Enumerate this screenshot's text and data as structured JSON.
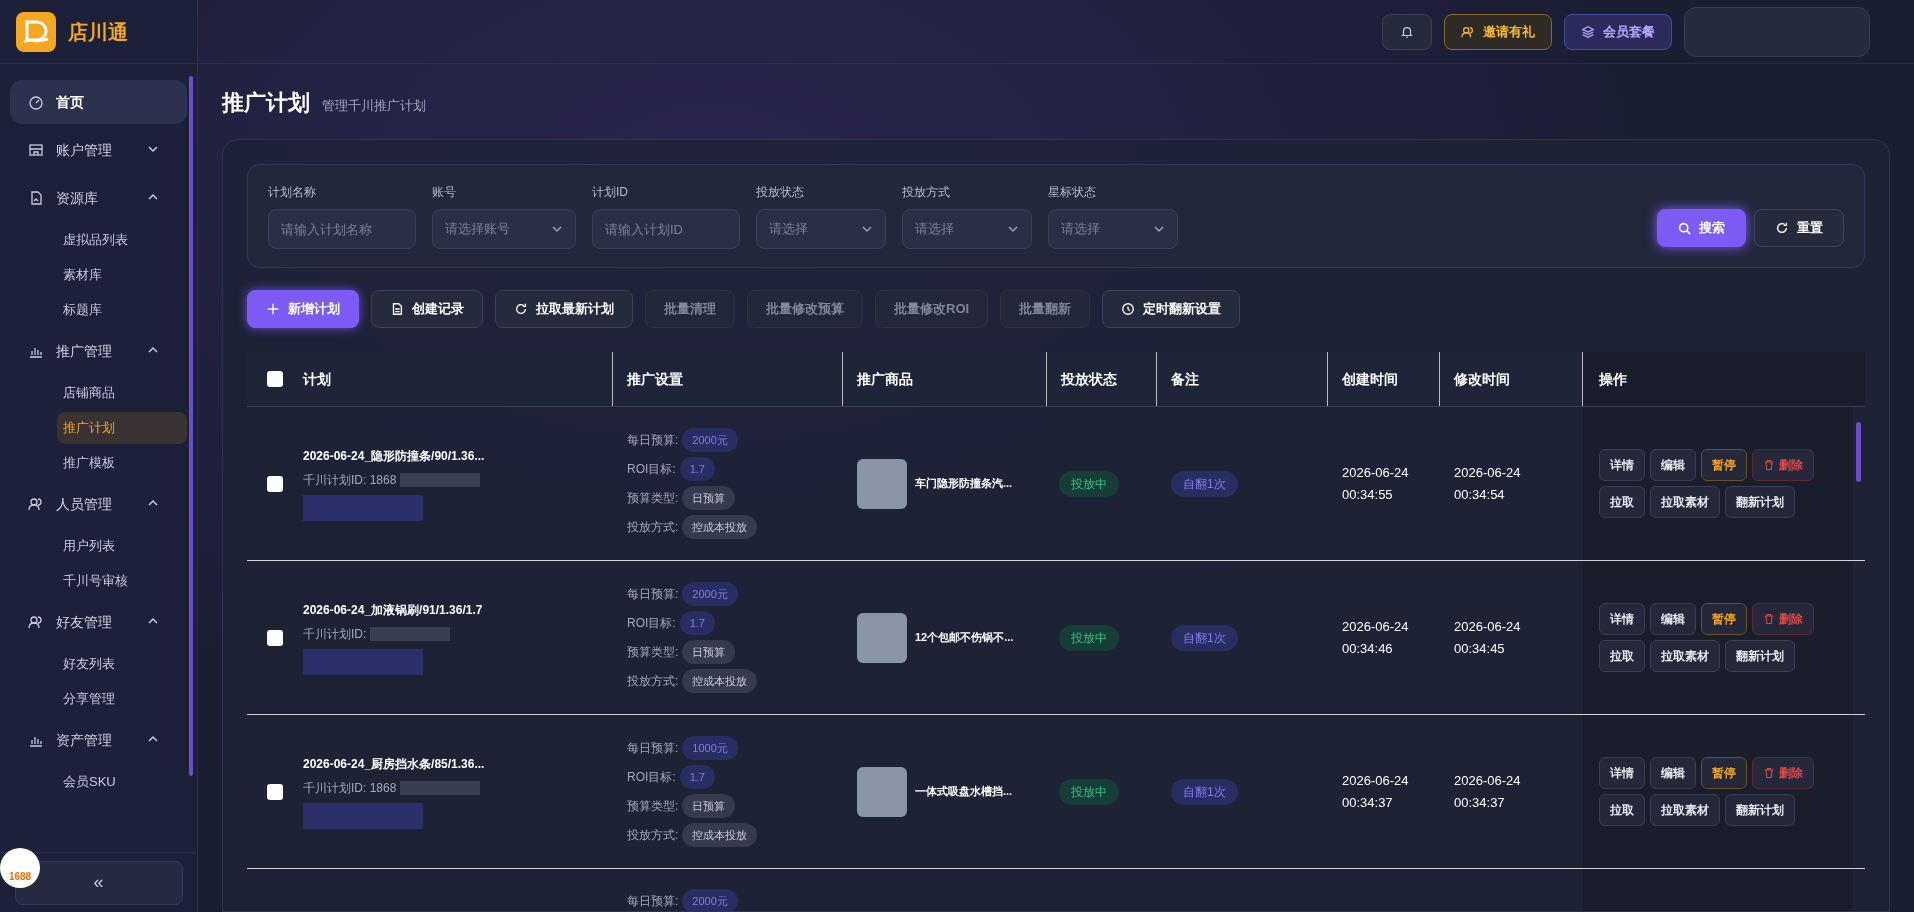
{
  "app": {
    "name": "店川通"
  },
  "sidebar": {
    "items": [
      {
        "label": "首页",
        "selected": true
      },
      {
        "label": "账户管理",
        "selected": false,
        "expanded": false
      },
      {
        "label": "资源库",
        "selected": false,
        "expanded": true,
        "children": [
          {
            "label": "虚拟品列表",
            "selected": false
          },
          {
            "label": "素材库",
            "selected": false
          },
          {
            "label": "标题库",
            "selected": false
          }
        ]
      },
      {
        "label": "推广管理",
        "selected": false,
        "expanded": true,
        "children": [
          {
            "label": "店铺商品",
            "selected": false
          },
          {
            "label": "推广计划",
            "selected": true
          },
          {
            "label": "推广模板",
            "selected": false
          }
        ]
      },
      {
        "label": "人员管理",
        "selected": false,
        "expanded": true,
        "children": [
          {
            "label": "用户列表",
            "selected": false
          },
          {
            "label": "千川号审核",
            "selected": false
          }
        ]
      },
      {
        "label": "好友管理",
        "selected": false,
        "expanded": true,
        "children": [
          {
            "label": "好友列表",
            "selected": false
          },
          {
            "label": "分享管理",
            "selected": false
          }
        ]
      },
      {
        "label": "资产管理",
        "selected": false,
        "expanded": true,
        "children": [
          {
            "label": "会员SKU",
            "selected": false
          }
        ]
      }
    ],
    "collapse_button": "«"
  },
  "corner_badge": "1688",
  "header": {
    "buttons": [
      {
        "kind": "icon"
      },
      {
        "kind": "gold",
        "label": "邀请有礼"
      },
      {
        "kind": "purple",
        "label": "会员套餐"
      }
    ]
  },
  "page": {
    "title": "推广计划",
    "subtitle": "管理千川推广计划"
  },
  "filters": [
    {
      "kind": "input",
      "label": "计划名称",
      "placeholder": "请输入计划名称"
    },
    {
      "kind": "select",
      "label": "账号",
      "placeholder": "请选择账号"
    },
    {
      "kind": "input",
      "label": "计划ID",
      "placeholder": "请输入计划ID"
    },
    {
      "kind": "select",
      "label": "投放状态",
      "placeholder": "请选择"
    },
    {
      "kind": "select",
      "label": "投放方式",
      "placeholder": "请选择"
    },
    {
      "kind": "select",
      "label": "星标状态",
      "placeholder": "请选择"
    }
  ],
  "filter_actions": [
    {
      "kind": "primary",
      "label": "搜索"
    },
    {
      "kind": "normal",
      "label": "重置"
    }
  ],
  "toolbar": [
    {
      "label": "新增计划",
      "kind": "primary",
      "disabled": false
    },
    {
      "label": "创建记录",
      "kind": "normal",
      "disabled": false
    },
    {
      "label": "拉取最新计划",
      "kind": "normal",
      "disabled": false
    },
    {
      "label": "批量清理",
      "kind": "normal",
      "disabled": true
    },
    {
      "label": "批量修改预算",
      "kind": "normal",
      "disabled": true
    },
    {
      "label": "批量修改ROI",
      "kind": "normal",
      "disabled": true
    },
    {
      "label": "批量翻新",
      "kind": "normal",
      "disabled": true
    },
    {
      "label": "定时翻新设置",
      "kind": "normal",
      "disabled": false
    }
  ],
  "table": {
    "select_all_checked": false,
    "columns": [
      "计划",
      "推广设置",
      "推广商品",
      "投放状态",
      "备注",
      "创建时间",
      "修改时间",
      "操作"
    ],
    "rows": [
      {
        "checked": false,
        "name": "2026-06-24_隐形防撞条/90/1.36...",
        "plan_id": "千川计划ID: 1868",
        "settings": [
          {
            "label": "每日预算:",
            "value": "2000元",
            "kind": "accent"
          },
          {
            "label": "ROI目标:",
            "value": "1.7",
            "kind": "accent"
          },
          {
            "label": "预算类型:",
            "value": "日预算",
            "kind": "plain"
          },
          {
            "label": "投放方式:",
            "value": "控成本投放",
            "kind": "plain"
          }
        ],
        "product": "车门隐形防撞条汽...",
        "status": "投放中",
        "note": "自翻1次",
        "created": "2026-06-24 00:34:55",
        "modified": "2026-06-24 00:34:54",
        "actions": [
          {
            "label": "详情",
            "kind": "normal"
          },
          {
            "label": "编辑",
            "kind": "normal"
          },
          {
            "label": "暂停",
            "kind": "warn"
          },
          {
            "label": "删除",
            "kind": "danger"
          },
          {
            "label": "拉取",
            "kind": "normal"
          },
          {
            "label": "拉取素材",
            "kind": "normal"
          },
          {
            "label": "翻新计划",
            "kind": "normal"
          }
        ]
      },
      {
        "checked": false,
        "name": "2026-06-24_加液锅刷/91/1.36/1.7",
        "plan_id": "千川计划ID:",
        "settings": [
          {
            "label": "每日预算:",
            "value": "2000元",
            "kind": "accent"
          },
          {
            "label": "ROI目标:",
            "value": "1.7",
            "kind": "accent"
          },
          {
            "label": "预算类型:",
            "value": "日预算",
            "kind": "plain"
          },
          {
            "label": "投放方式:",
            "value": "控成本投放",
            "kind": "plain"
          }
        ],
        "product": "12个包邮不伤锅不...",
        "status": "投放中",
        "note": "自翻1次",
        "created": "2026-06-24 00:34:46",
        "modified": "2026-06-24 00:34:45",
        "actions": [
          {
            "label": "详情",
            "kind": "normal"
          },
          {
            "label": "编辑",
            "kind": "normal"
          },
          {
            "label": "暂停",
            "kind": "warn"
          },
          {
            "label": "删除",
            "kind": "danger"
          },
          {
            "label": "拉取",
            "kind": "normal"
          },
          {
            "label": "拉取素材",
            "kind": "normal"
          },
          {
            "label": "翻新计划",
            "kind": "normal"
          }
        ]
      },
      {
        "checked": false,
        "name": "2026-06-24_厨房挡水条/85/1.36...",
        "plan_id": "千川计划ID: 1868",
        "settings": [
          {
            "label": "每日预算:",
            "value": "1000元",
            "kind": "accent"
          },
          {
            "label": "ROI目标:",
            "value": "1.7",
            "kind": "accent"
          },
          {
            "label": "预算类型:",
            "value": "日预算",
            "kind": "plain"
          },
          {
            "label": "投放方式:",
            "value": "控成本投放",
            "kind": "plain"
          }
        ],
        "product": "一体式吸盘水槽挡...",
        "status": "投放中",
        "note": "自翻1次",
        "created": "2026-06-24 00:34:37",
        "modified": "2026-06-24 00:34:37",
        "actions": [
          {
            "label": "详情",
            "kind": "normal"
          },
          {
            "label": "编辑",
            "kind": "normal"
          },
          {
            "label": "暂停",
            "kind": "warn"
          },
          {
            "label": "删除",
            "kind": "danger"
          },
          {
            "label": "拉取",
            "kind": "normal"
          },
          {
            "label": "拉取素材",
            "kind": "normal"
          },
          {
            "label": "翻新计划",
            "kind": "normal"
          }
        ]
      },
      {
        "settings": [
          {
            "label": "每日预算:",
            "value": "2000元",
            "kind": "accent"
          }
        ]
      }
    ]
  }
}
